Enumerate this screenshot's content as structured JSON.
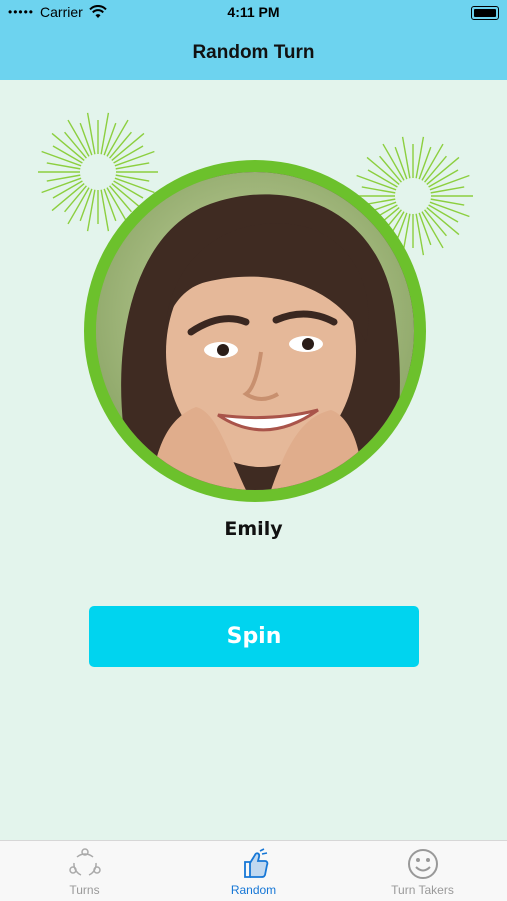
{
  "status_bar": {
    "carrier": "Carrier",
    "time": "4:11 PM",
    "icons": [
      "signal-dots-icon",
      "wifi-icon",
      "battery-icon"
    ]
  },
  "nav": {
    "title": "Random Turn"
  },
  "turn_taker": {
    "name": "Emily",
    "ring_color": "#6cc12c"
  },
  "spin_button": {
    "label": "Spin",
    "color": "#00d4ef"
  },
  "tab_bar": {
    "active_color": "#1677d6",
    "items": [
      {
        "label": "Turns",
        "icon": "turns-cycle-icon",
        "active": false
      },
      {
        "label": "Random",
        "icon": "thumbs-up-icon",
        "active": true
      },
      {
        "label": "Turn Takers",
        "icon": "smiley-face-icon",
        "active": false
      }
    ]
  },
  "colors": {
    "header": "#6dd3ef",
    "background": "#e3f4ec",
    "burst": "#8ccf3f"
  }
}
